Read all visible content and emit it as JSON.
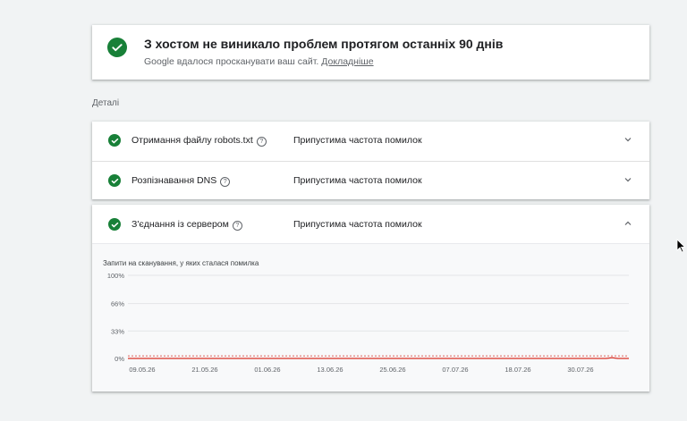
{
  "summary": {
    "title": "З хостом не виникало проблем протягом останніх 90 днів",
    "subtitle": "Google вдалося просканувати ваш сайт.",
    "learn_more": "Докладніше"
  },
  "details_label": "Деталі",
  "rows": [
    {
      "title": "Отримання файлу robots.txt",
      "status": "Припустима частота помилок"
    },
    {
      "title": "Розпізнавання DNS",
      "status": "Припустима частота помилок"
    }
  ],
  "expanded_row": {
    "title": "З'єднання із сервером",
    "status": "Припустима частота помилок"
  },
  "colors": {
    "success": "#188038",
    "line": "#d93025",
    "threshold": "#d93025"
  },
  "icons": [
    "check-circle-icon",
    "help-icon",
    "chevron-down-icon",
    "chevron-up-icon",
    "mouse-cursor-icon"
  ],
  "chart_data": {
    "type": "line",
    "title": "Запити на сканування, у яких сталася помилка",
    "y_ticks": [
      "100%",
      "66%",
      "33%",
      "0%"
    ],
    "ylim": [
      0,
      100
    ],
    "x_tick_labels": [
      "09.05.26",
      "21.05.26",
      "01.06.26",
      "13.06.26",
      "25.06.26",
      "07.07.26",
      "18.07.26",
      "30.07.26"
    ],
    "threshold": 2,
    "series": [
      {
        "values": [
          0,
          0,
          0,
          0,
          0,
          0,
          0,
          0,
          0,
          0,
          0,
          0,
          0,
          0,
          0,
          0,
          0,
          0,
          0,
          0,
          0,
          0,
          0,
          0,
          0,
          0,
          0,
          0,
          0,
          0,
          0,
          0,
          0,
          0,
          0,
          0,
          0,
          0,
          0,
          0,
          0,
          0,
          0,
          0,
          0,
          0,
          0,
          0,
          0,
          0,
          0,
          0,
          0,
          0,
          0,
          0,
          0,
          0,
          0,
          0,
          0,
          0,
          0,
          0,
          0,
          0,
          0,
          0,
          0,
          0,
          0,
          0,
          0,
          0,
          0,
          0,
          0,
          0,
          0,
          0,
          0,
          0,
          0,
          0,
          0,
          0,
          1,
          0,
          0,
          0
        ]
      }
    ]
  }
}
